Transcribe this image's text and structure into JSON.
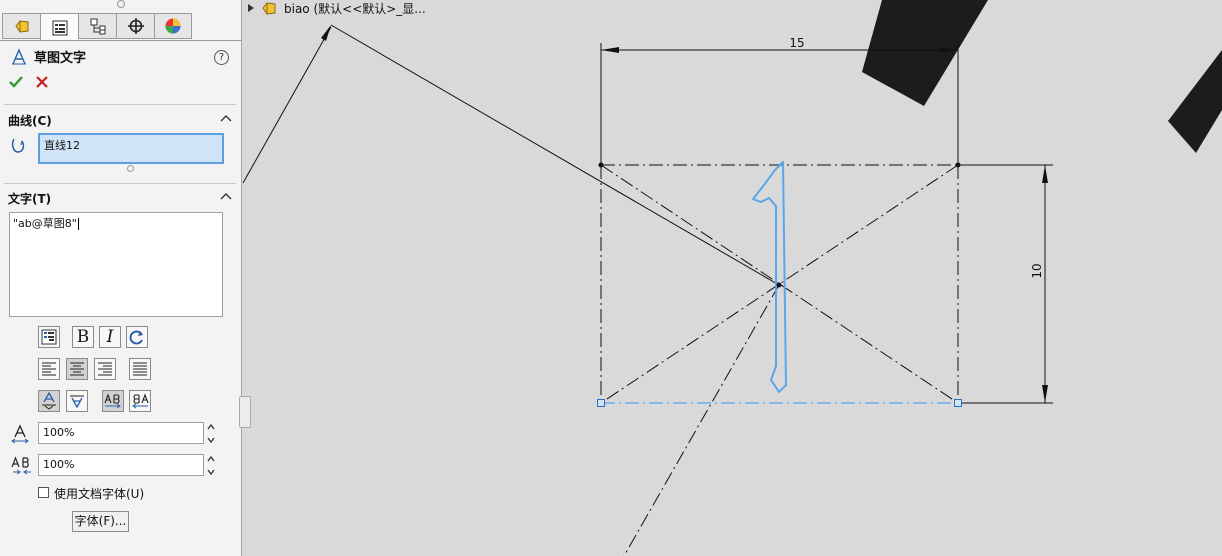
{
  "panel": {
    "tabs": [
      {
        "name": "feature-manager-tab-icon"
      },
      {
        "name": "property-manager-tab-icon"
      },
      {
        "name": "configuration-manager-tab-icon"
      },
      {
        "name": "dimxpert-manager-tab-icon"
      },
      {
        "name": "display-manager-tab-icon"
      }
    ],
    "title": "草图文字",
    "help": "?",
    "curves_section": {
      "header": "曲线(C)",
      "selected_item": "直线12"
    },
    "text_section": {
      "header": "文字(T)",
      "content": "\"ab@草图8\""
    },
    "toolbar": {
      "bold": "B",
      "italic": "I"
    },
    "width_factor": "100%",
    "spacing": "100%",
    "use_doc_font": {
      "label": "使用文档字体(U)",
      "checked": false
    },
    "font_button": "字体(F)..."
  },
  "breadcrumb": {
    "text": "biao  (默认<<默认>_显..."
  },
  "sketch": {
    "dimension_horizontal": "15",
    "dimension_vertical": "10",
    "sketch_text": "1",
    "colors": {
      "geometry": "#111111",
      "selected": "#5aa6ea",
      "background": "#d9d9d9",
      "solid_body": "#1c1c1c"
    }
  }
}
